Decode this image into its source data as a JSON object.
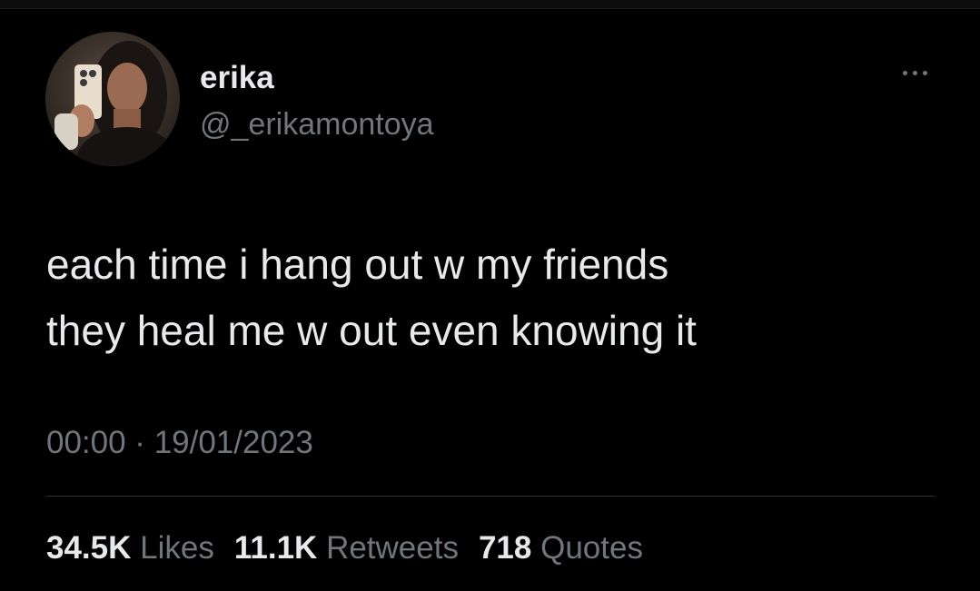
{
  "user": {
    "display_name": "erika",
    "handle": "@_erikamontoya"
  },
  "tweet": {
    "lines": [
      "each time i hang out w my friends",
      "they heal me w out even knowing it"
    ],
    "timestamp": "00:00 · 19/01/2023"
  },
  "stats": {
    "likes_count": "34.5K",
    "likes_label": "Likes",
    "retweets_count": "11.1K",
    "retweets_label": "Retweets",
    "quotes_count": "718",
    "quotes_label": "Quotes"
  },
  "icons": {
    "more": "more-horizontal-icon"
  },
  "colors": {
    "background": "#000000",
    "primary_text": "#e7e9ea",
    "secondary_text": "#71767b",
    "divider": "#2f3336"
  }
}
